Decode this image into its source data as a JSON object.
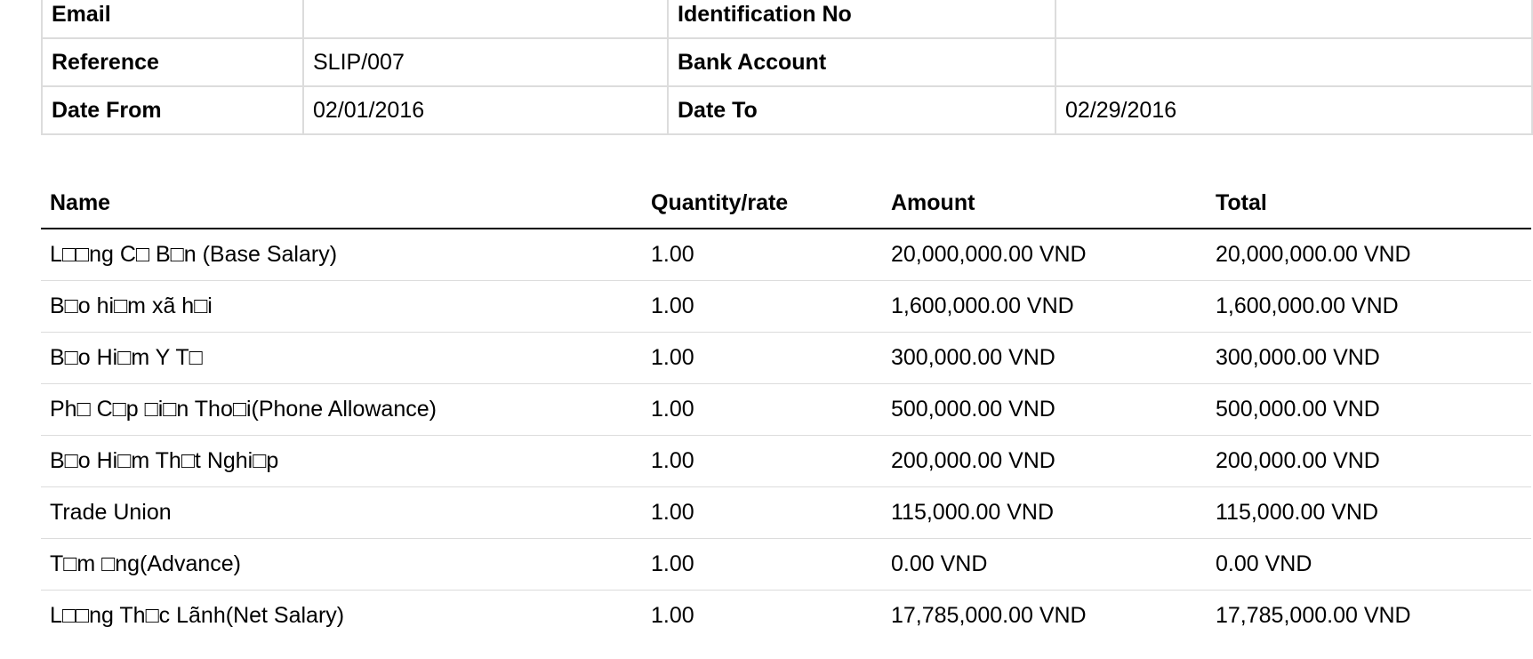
{
  "info": {
    "rows": [
      {
        "label1": "Email",
        "value1": "",
        "label2": "Identification No",
        "value2": ""
      },
      {
        "label1": "Reference",
        "value1": "SLIP/007",
        "label2": "Bank Account",
        "value2": ""
      },
      {
        "label1": "Date From",
        "value1": "02/01/2016",
        "label2": "Date To",
        "value2": "02/29/2016"
      }
    ]
  },
  "lines": {
    "headers": {
      "name": "Name",
      "quantity": "Quantity/rate",
      "amount": "Amount",
      "total": "Total"
    },
    "rows": [
      {
        "name": "L□□ng C□ B□n (Base Salary)",
        "quantity": "1.00",
        "amount": "20,000,000.00 VND",
        "total": "20,000,000.00 VND"
      },
      {
        "name": "B□o hi□m xã h□i",
        "quantity": "1.00",
        "amount": "1,600,000.00 VND",
        "total": "1,600,000.00 VND"
      },
      {
        "name": "B□o Hi□m Y T□",
        "quantity": "1.00",
        "amount": "300,000.00 VND",
        "total": "300,000.00 VND"
      },
      {
        "name": "Ph□ C□p □i□n Tho□i(Phone Allowance)",
        "quantity": "1.00",
        "amount": "500,000.00 VND",
        "total": "500,000.00 VND"
      },
      {
        "name": "B□o Hi□m Th□t Nghi□p",
        "quantity": "1.00",
        "amount": "200,000.00 VND",
        "total": "200,000.00 VND"
      },
      {
        "name": "Trade Union",
        "quantity": "1.00",
        "amount": "115,000.00 VND",
        "total": "115,000.00 VND"
      },
      {
        "name": "T□m □ng(Advance)",
        "quantity": "1.00",
        "amount": "0.00 VND",
        "total": "0.00 VND"
      },
      {
        "name": "L□□ng Th□c Lãnh(Net Salary)",
        "quantity": "1.00",
        "amount": "17,785,000.00 VND",
        "total": "17,785,000.00 VND"
      }
    ]
  }
}
